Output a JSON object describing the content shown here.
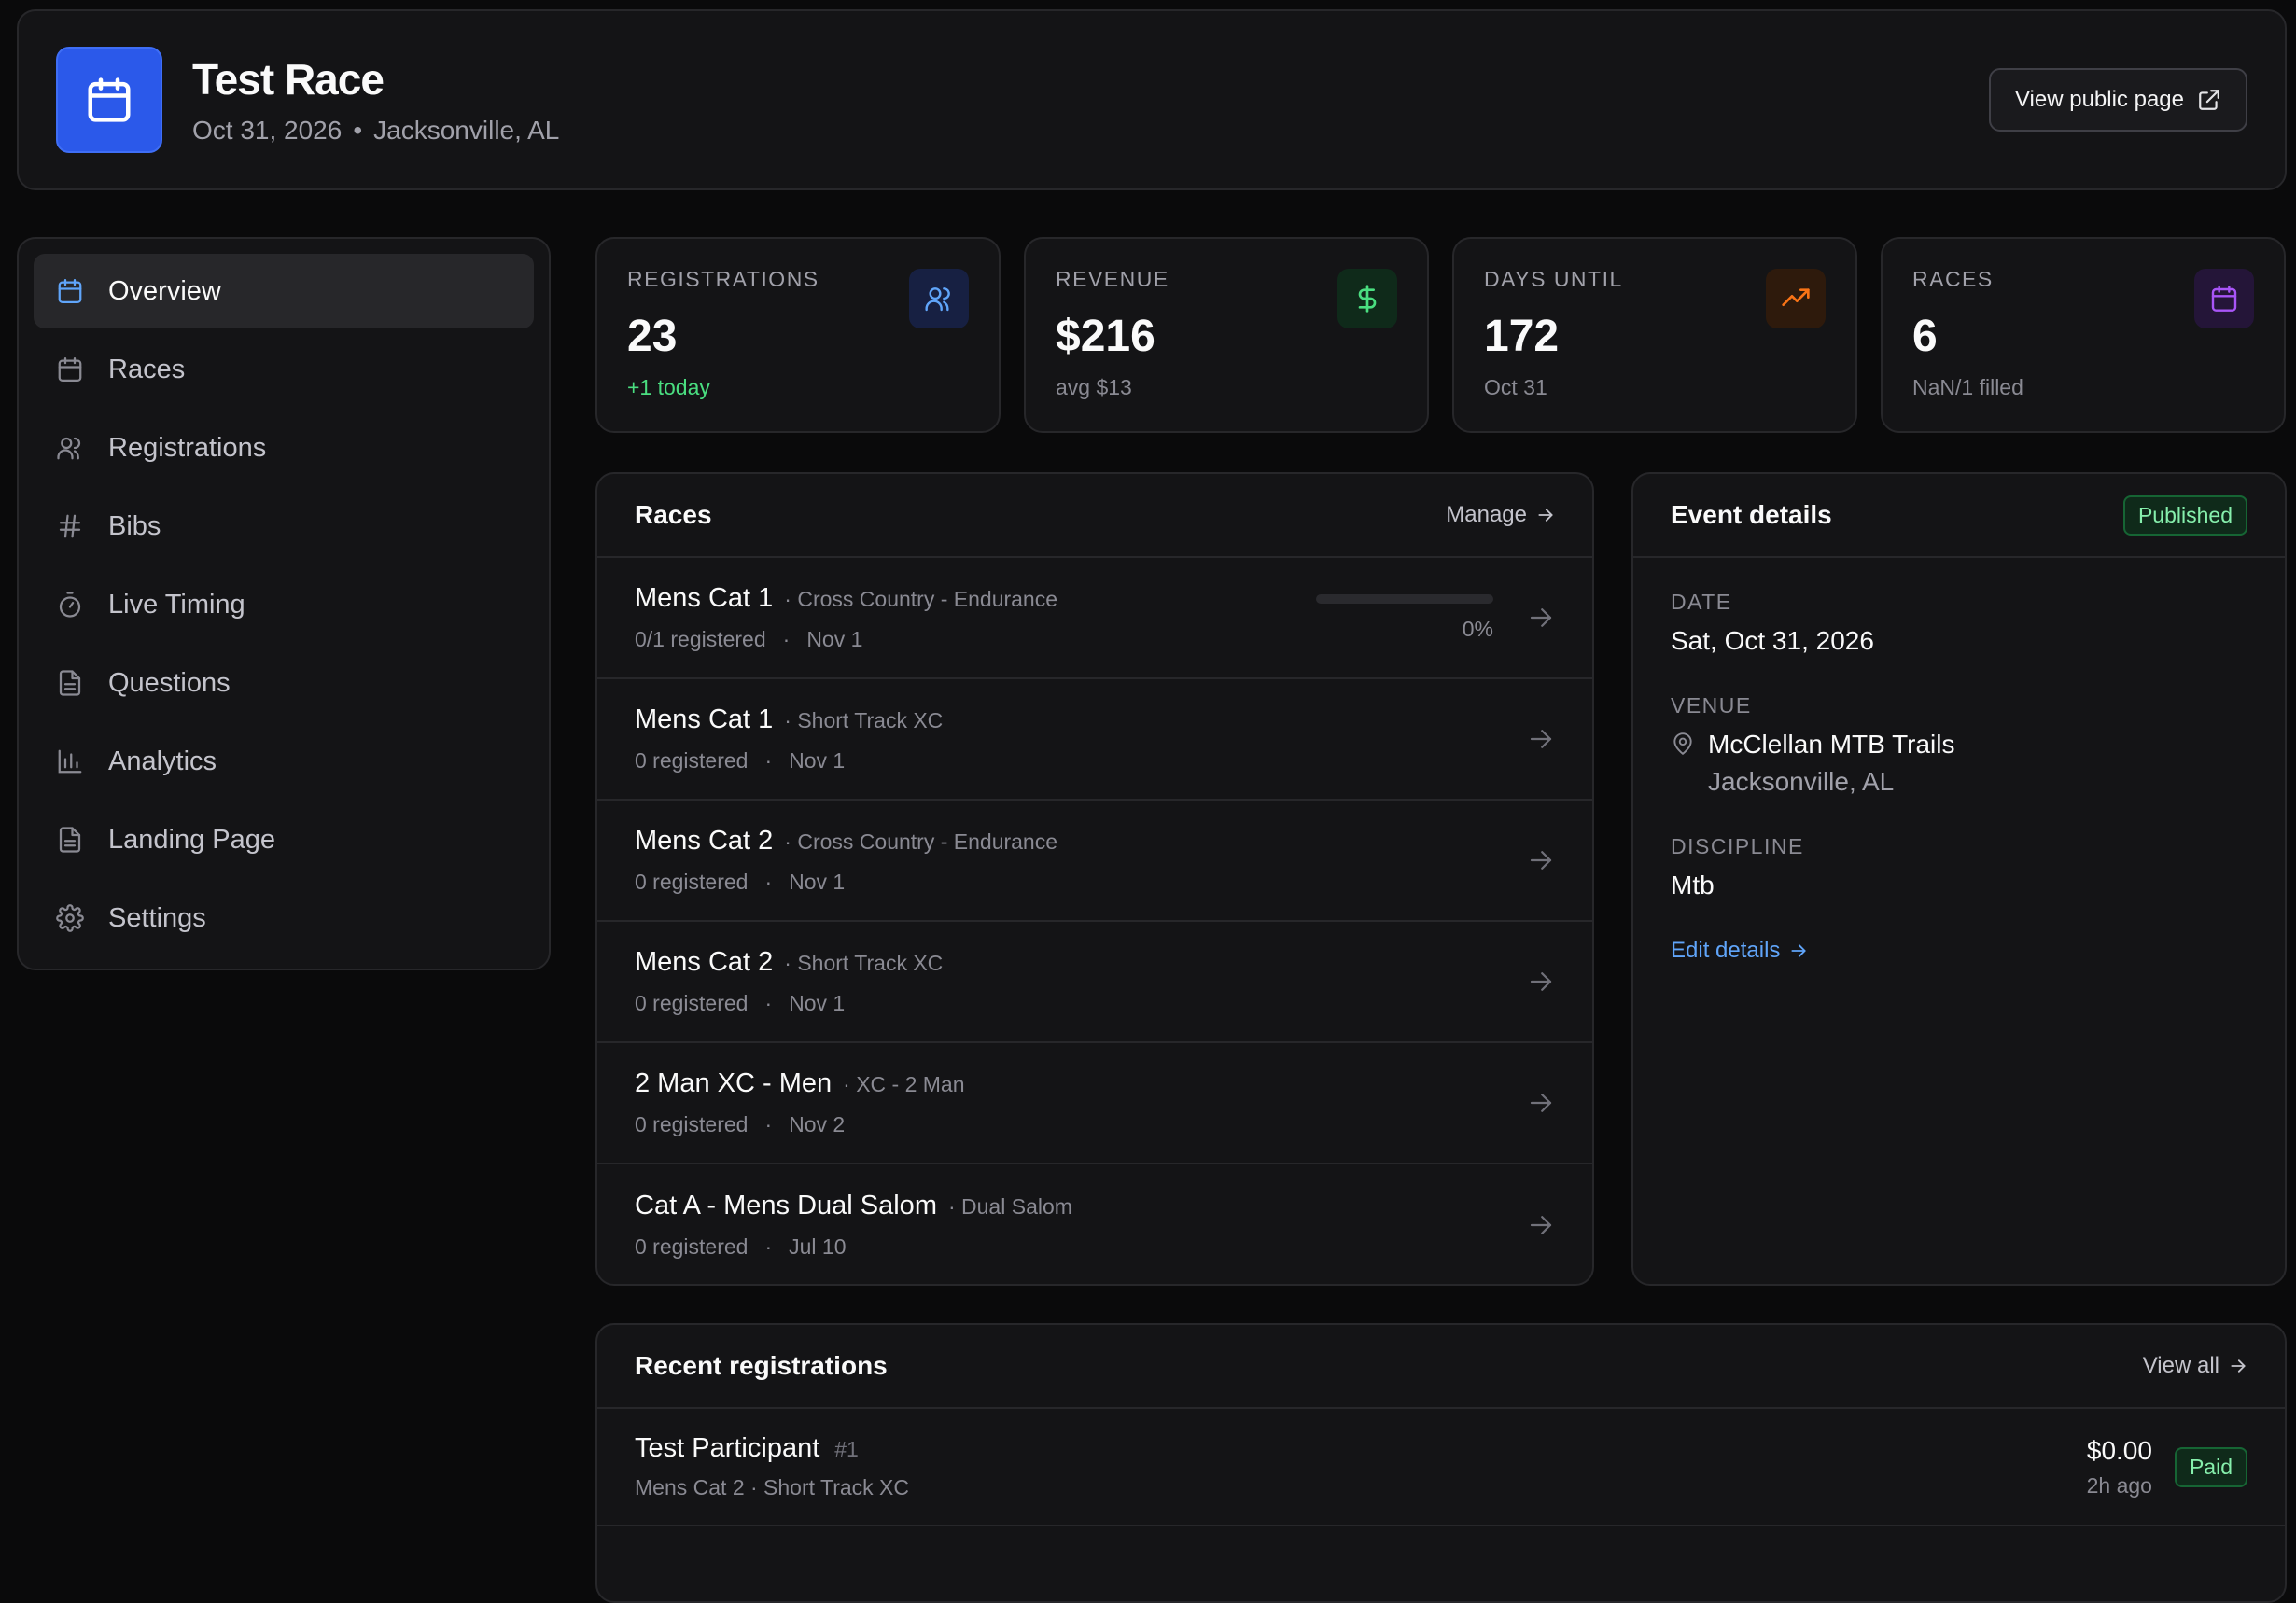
{
  "colors": {
    "accent_blue": "#2b59ea",
    "success_green": "#4ade80",
    "link_blue": "#60a5fa",
    "orange": "#f97316",
    "purple": "#a855f7"
  },
  "header": {
    "logo_icon": "calendar-icon",
    "title": "Test Race",
    "date": "Oct 31, 2026",
    "separator": "•",
    "location": "Jacksonville, AL",
    "public_button": "View public page",
    "public_button_icon": "external-link-icon"
  },
  "sidebar": {
    "items": [
      {
        "label": "Overview",
        "icon": "calendar-icon",
        "active": true
      },
      {
        "label": "Races",
        "icon": "calendar-icon"
      },
      {
        "label": "Registrations",
        "icon": "users-icon"
      },
      {
        "label": "Bibs",
        "icon": "hash-icon"
      },
      {
        "label": "Live Timing",
        "icon": "stopwatch-icon"
      },
      {
        "label": "Questions",
        "icon": "document-icon"
      },
      {
        "label": "Analytics",
        "icon": "bar-chart-icon"
      },
      {
        "label": "Landing Page",
        "icon": "document-icon"
      },
      {
        "label": "Settings",
        "icon": "gear-icon"
      }
    ]
  },
  "stats": {
    "registrations": {
      "label": "REGISTRATIONS",
      "value": "23",
      "sub": "+1 today",
      "icon": "users-icon"
    },
    "revenue": {
      "label": "REVENUE",
      "value": "$216",
      "sub": "avg $13",
      "icon": "dollar-icon"
    },
    "days_until": {
      "label": "DAYS UNTIL",
      "value": "172",
      "sub": "Oct 31",
      "icon": "trending-up-icon"
    },
    "races": {
      "label": "RACES",
      "value": "6",
      "sub": "NaN/1 filled",
      "icon": "calendar-icon"
    }
  },
  "races_panel": {
    "title": "Races",
    "manage_label": "Manage",
    "items": [
      {
        "name": "Mens Cat 1",
        "discipline": "· Cross Country - Endurance",
        "registered": "0/1 registered",
        "sep": "·",
        "date": "Nov 1",
        "progress": 0,
        "progress_label": "0%"
      },
      {
        "name": "Mens Cat 1",
        "discipline": "· Short Track XC",
        "registered": "0 registered",
        "sep": "·",
        "date": "Nov 1"
      },
      {
        "name": "Mens Cat 2",
        "discipline": "· Cross Country - Endurance",
        "registered": "0 registered",
        "sep": "·",
        "date": "Nov 1"
      },
      {
        "name": "Mens Cat 2",
        "discipline": "· Short Track XC",
        "registered": "0 registered",
        "sep": "·",
        "date": "Nov 1"
      },
      {
        "name": "2 Man XC - Men",
        "discipline": "· XC - 2 Man",
        "registered": "0 registered",
        "sep": "·",
        "date": "Nov 2"
      },
      {
        "name": "Cat A - Mens Dual Salom",
        "discipline": "· Dual Salom",
        "registered": "0 registered",
        "sep": "·",
        "date": "Jul 10"
      }
    ]
  },
  "details_panel": {
    "title": "Event details",
    "status": "Published",
    "date_label": "DATE",
    "date_value": "Sat, Oct 31, 2026",
    "venue_label": "VENUE",
    "venue_name": "McClellan MTB Trails",
    "venue_city": "Jacksonville, AL",
    "discipline_label": "DISCIPLINE",
    "discipline_value": "Mtb",
    "edit_label": "Edit details"
  },
  "recent_panel": {
    "title": "Recent registrations",
    "view_all_label": "View all",
    "items": [
      {
        "name": "Test Participant",
        "bib": "#1",
        "race": "Mens Cat 2 · Short Track XC",
        "amount": "$0.00",
        "time": "2h ago",
        "status": "Paid"
      }
    ]
  }
}
